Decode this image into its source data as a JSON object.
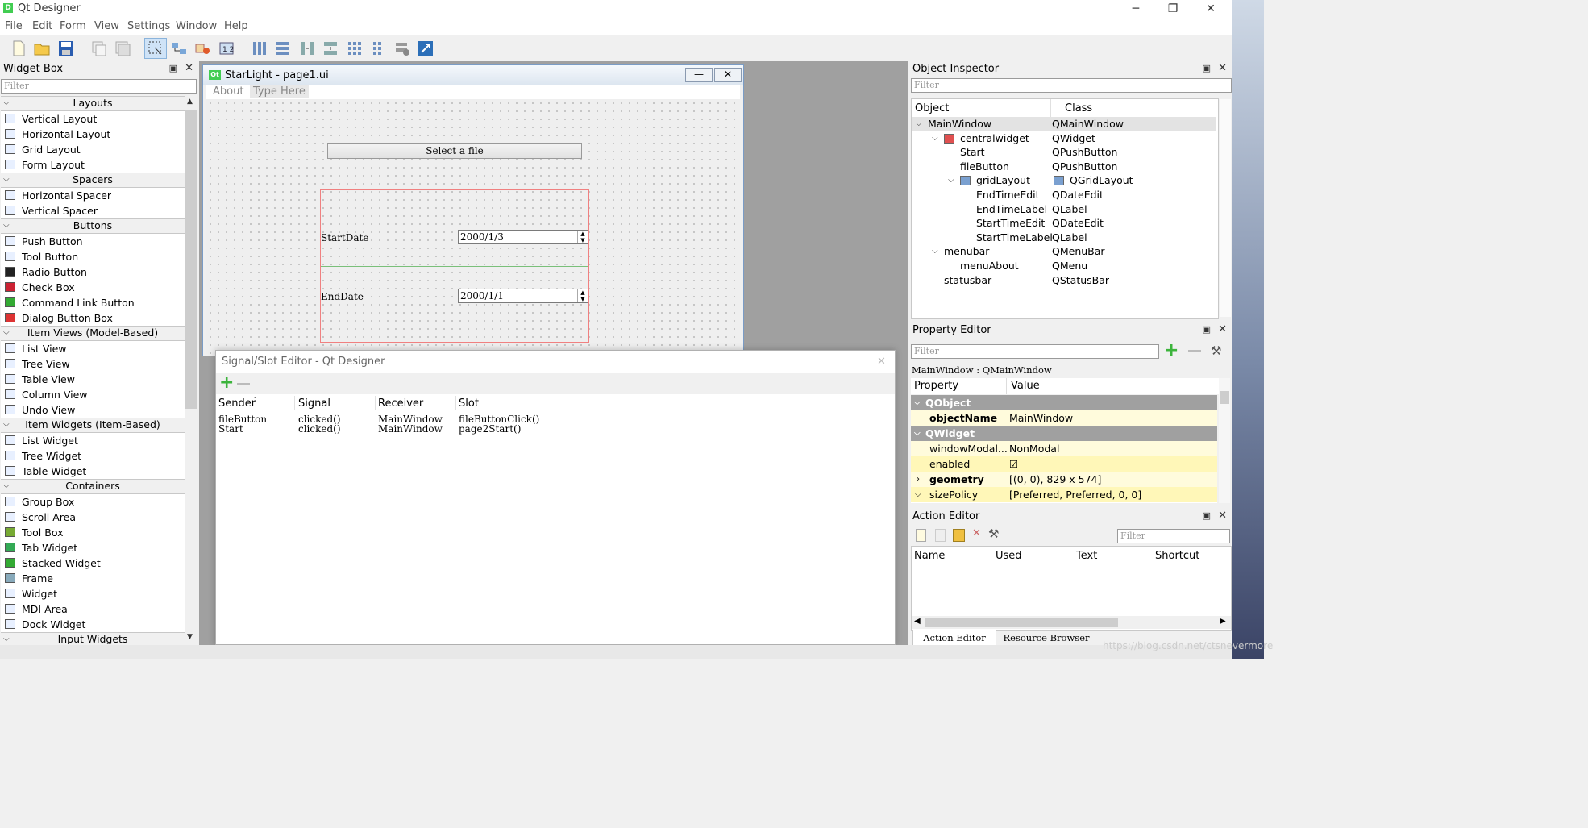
{
  "window": {
    "title": "Qt Designer",
    "app_icon": "D",
    "controls": {
      "minimize": "─",
      "restore": "❐",
      "close": "✕"
    }
  },
  "menu": [
    "File",
    "Edit",
    "Form",
    "View",
    "Settings",
    "Window",
    "Help"
  ],
  "widget_box": {
    "title": "Widget Box",
    "filter_placeholder": "Filter",
    "categories": [
      {
        "name": "Layouts",
        "items": [
          "Vertical Layout",
          "Horizontal Layout",
          "Grid Layout",
          "Form Layout"
        ]
      },
      {
        "name": "Spacers",
        "items": [
          "Horizontal Spacer",
          "Vertical Spacer"
        ]
      },
      {
        "name": "Buttons",
        "items": [
          "Push Button",
          "Tool Button",
          "Radio Button",
          "Check Box",
          "Command Link Button",
          "Dialog Button Box"
        ]
      },
      {
        "name": "Item Views (Model-Based)",
        "items": [
          "List View",
          "Tree View",
          "Table View",
          "Column View",
          "Undo View"
        ]
      },
      {
        "name": "Item Widgets (Item-Based)",
        "items": [
          "List Widget",
          "Tree Widget",
          "Table Widget"
        ]
      },
      {
        "name": "Containers",
        "items": [
          "Group Box",
          "Scroll Area",
          "Tool Box",
          "Tab Widget",
          "Stacked Widget",
          "Frame",
          "Widget",
          "MDI Area",
          "Dock Widget"
        ]
      },
      {
        "name": "Input Widgets",
        "items": []
      }
    ]
  },
  "form": {
    "title": "StarLight - page1.ui",
    "icon": "Qt",
    "menu": [
      "About",
      "Type Here"
    ],
    "select_button": "Select a file",
    "start_label": "StartDate",
    "start_value": "2000/1/3",
    "end_label": "EndDate",
    "end_value": "2000/1/1"
  },
  "signal_slot_editor": {
    "title": "Signal/Slot Editor - Qt Designer",
    "columns": [
      "Sender",
      "Signal",
      "Receiver",
      "Slot"
    ],
    "rows": [
      [
        "fileButton",
        "clicked()",
        "MainWindow",
        "fileButtonClick()"
      ],
      [
        "Start",
        "clicked()",
        "MainWindow",
        "page2Start()"
      ]
    ]
  },
  "object_inspector": {
    "title": "Object Inspector",
    "filter_placeholder": "Filter",
    "columns": [
      "Object",
      "Class"
    ],
    "rows": [
      {
        "object": "MainWindow",
        "class": "QMainWindow",
        "depth": 0,
        "expanded": true
      },
      {
        "object": "centralwidget",
        "class": "QWidget",
        "depth": 1,
        "expanded": true
      },
      {
        "object": "Start",
        "class": "QPushButton",
        "depth": 2
      },
      {
        "object": "fileButton",
        "class": "QPushButton",
        "depth": 2
      },
      {
        "object": "gridLayout",
        "class": "QGridLayout",
        "depth": 2,
        "expanded": true
      },
      {
        "object": "EndTimeEdit",
        "class": "QDateEdit",
        "depth": 3
      },
      {
        "object": "EndTimeLabel",
        "class": "QLabel",
        "depth": 3
      },
      {
        "object": "StartTimeEdit",
        "class": "QDateEdit",
        "depth": 3
      },
      {
        "object": "StartTimeLabel",
        "class": "QLabel",
        "depth": 3
      },
      {
        "object": "menubar",
        "class": "QMenuBar",
        "depth": 1,
        "expanded": true
      },
      {
        "object": "menuAbout",
        "class": "QMenu",
        "depth": 2
      },
      {
        "object": "statusbar",
        "class": "QStatusBar",
        "depth": 1
      }
    ]
  },
  "property_editor": {
    "title": "Property Editor",
    "filter_placeholder": "Filter",
    "context": "MainWindow : QMainWindow",
    "columns": [
      "Property",
      "Value"
    ],
    "rows": [
      {
        "type": "group",
        "name": "QObject"
      },
      {
        "name": "objectName",
        "value": "MainWindow",
        "bold": true
      },
      {
        "type": "group",
        "name": "QWidget"
      },
      {
        "name": "windowModal...",
        "value": "NonModal"
      },
      {
        "name": "enabled",
        "value": "☑"
      },
      {
        "name": "geometry",
        "value": "[(0, 0), 829 x 574]",
        "bold": true
      },
      {
        "name": "sizePolicy",
        "value": "[Preferred, Preferred, 0, 0]"
      }
    ]
  },
  "action_editor": {
    "title": "Action Editor",
    "filter_placeholder": "Filter",
    "columns": [
      "Name",
      "Used",
      "Text",
      "Shortcut"
    ],
    "tabs": [
      "Action Editor",
      "Resource Browser"
    ]
  },
  "watermark": "https://blog.csdn.net/ctsnevermore"
}
